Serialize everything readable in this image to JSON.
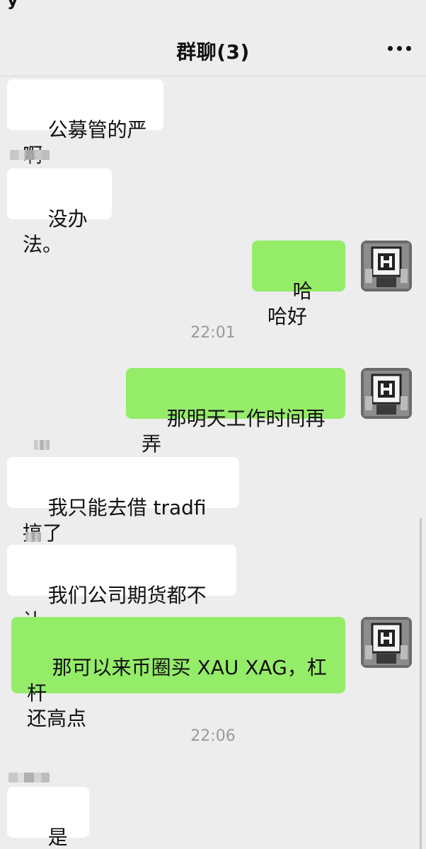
{
  "status_bar": {
    "partial_glyph": "y"
  },
  "header": {
    "title": "群聊(3)",
    "more_icon": "more-dots-icon"
  },
  "messages": [
    {
      "side": "left",
      "text": "公募管的严啊"
    },
    {
      "side": "left",
      "text": "没办法。"
    },
    {
      "side": "right",
      "text": "哈哈好"
    },
    {
      "type": "time",
      "text": "22:01"
    },
    {
      "side": "right",
      "text": "那明天工作时间再弄"
    },
    {
      "side": "left",
      "text": "我只能去借 tradfi 搞了"
    },
    {
      "side": "left",
      "text": "我们公司期货都不让。"
    },
    {
      "side": "right",
      "text": "那可以来币圈买 XAU XAG，杠杆\n还高点"
    },
    {
      "type": "time",
      "text": "22:06"
    },
    {
      "side": "left",
      "text": "是的。"
    }
  ],
  "colors": {
    "background": "#ededed",
    "self_bubble": "#95ec69",
    "other_bubble": "#ffffff",
    "time_text": "#9a9a9a"
  }
}
